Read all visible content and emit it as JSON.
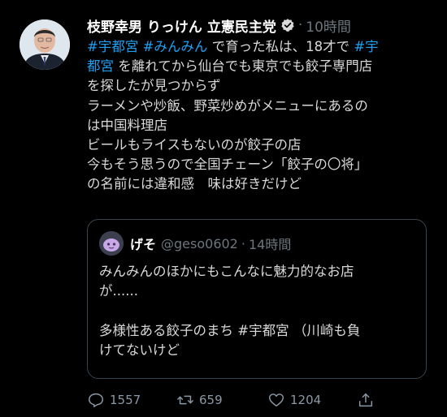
{
  "tweet": {
    "author": "枝野幸男 りっけん 立憲民主党",
    "separator": "·",
    "time": "10時間",
    "lines": [
      [
        {
          "t": "#宇都宮",
          "tag": true
        },
        {
          "t": " ",
          "tag": false
        },
        {
          "t": "#みんみん",
          "tag": true
        },
        {
          "t": " で育った私は、18才で ",
          "tag": false
        },
        {
          "t": "#宇",
          "tag": true
        }
      ],
      [
        {
          "t": "都宮",
          "tag": true
        },
        {
          "t": " を離れてから仙台でも東京でも餃子専門店",
          "tag": false
        }
      ],
      [
        {
          "t": "を探したが見つからず",
          "tag": false
        }
      ],
      [
        {
          "t": "ラーメンや炒飯、野菜炒めがメニューにあるの",
          "tag": false
        }
      ],
      [
        {
          "t": "は中国料理店",
          "tag": false
        }
      ],
      [
        {
          "t": "ビールもライスもないのが餃子の店",
          "tag": false
        }
      ],
      [
        {
          "t": "今もそう思うので全国チェーン「餃子の〇将」",
          "tag": false
        }
      ],
      [
        {
          "t": "の名前には違和感　味は好きだけど",
          "tag": false
        }
      ]
    ]
  },
  "quote": {
    "name": "げそ",
    "handle": "@geso0602",
    "separator": "·",
    "time": "14時間",
    "lines": [
      [
        {
          "t": "みんみんのほかにもこんなに魅力的なお店",
          "tag": false
        }
      ],
      [
        {
          "t": "が......",
          "tag": false
        }
      ],
      [],
      [
        {
          "t": "多様性ある餃子のまち ",
          "tag": false
        },
        {
          "t": "#宇都宮",
          "tag": false
        },
        {
          "t": " （川崎も負",
          "tag": false
        }
      ],
      [
        {
          "t": "けてないけど",
          "tag": false
        }
      ]
    ]
  },
  "actions": {
    "replies": "1557",
    "retweets": "659",
    "likes": "1204",
    "icons": [
      "reply-icon",
      "retweet-icon",
      "like-icon",
      "share-icon"
    ]
  },
  "colors": {
    "background": "#000000",
    "text": "#d9d9d9",
    "hashtag": "#1da1f2",
    "muted": "#6e767d",
    "border": "#38444d"
  }
}
